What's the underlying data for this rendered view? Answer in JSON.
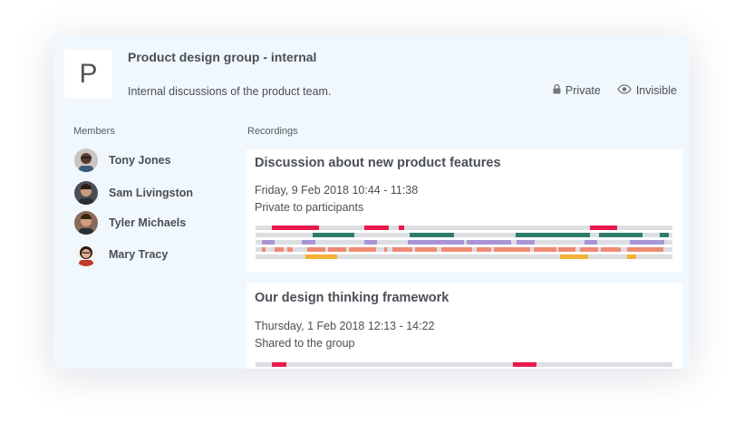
{
  "group": {
    "avatar_letter": "P",
    "title": "Product design group - internal",
    "description": "Internal discussions of the product team.",
    "privacy_label": "Private",
    "visibility_label": "Invisible"
  },
  "members": {
    "label": "Members",
    "items": [
      {
        "name": "Tony Jones"
      },
      {
        "name": "Sam Livingston"
      },
      {
        "name": "Tyler Michaels"
      },
      {
        "name": "Mary Tracy"
      }
    ]
  },
  "recordings": {
    "label": "Recordings",
    "items": [
      {
        "title": "Discussion about new product features",
        "date": "Friday, 9 Feb 2018 10:44 - 11:38",
        "sharing": "Private to participants"
      },
      {
        "title": "Our design thinking framework",
        "date": "Thursday, 1 Feb 2018 12:13 - 14:22",
        "sharing": "Shared to the group"
      }
    ]
  },
  "colors": {
    "red": "#e8194d",
    "green": "#2e7d6a",
    "purple": "#a995d6",
    "salmon": "#ef8a72",
    "yellow": "#f2b233",
    "track": "#dcdee2"
  }
}
